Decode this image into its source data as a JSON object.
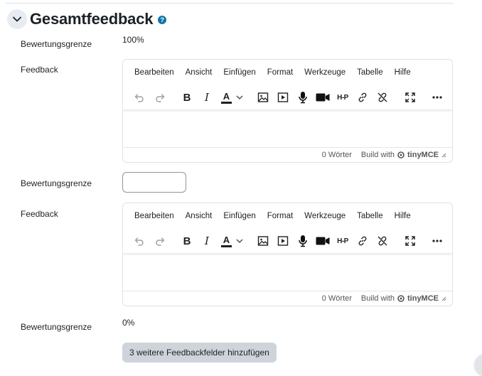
{
  "section": {
    "title": "Gesamtfeedback",
    "help_glyph": "?"
  },
  "rows": {
    "grade_label_1": "Bewertungsgrenze",
    "grade_value_1": "100%",
    "feedback_label_1": "Feedback",
    "grade_label_2": "Bewertungsgrenze",
    "grade_input_value": "",
    "feedback_label_2": "Feedback",
    "grade_label_3": "Bewertungsgrenze",
    "grade_value_3": "0%"
  },
  "editor": {
    "menu": [
      "Bearbeiten",
      "Ansicht",
      "Einfügen",
      "Format",
      "Werkzeuge",
      "Tabelle",
      "Hilfe"
    ],
    "toolbar_icons": [
      "undo-icon",
      "redo-icon",
      "bold-icon",
      "italic-icon",
      "text-color-icon",
      "image-icon",
      "media-icon",
      "microphone-icon",
      "video-camera-icon",
      "h5p-icon",
      "link-icon",
      "unlink-icon",
      "fullscreen-icon",
      "more-icon"
    ],
    "bold_glyph": "B",
    "italic_glyph": "I",
    "color_glyph": "A",
    "h5p_text": "H-P",
    "word_count": "0 Wörter",
    "brand_text": "Build with",
    "brand_logo": "tinyMCE"
  },
  "actions": {
    "add_fields": "3 weitere Feedbackfelder hinzufügen"
  },
  "colors": {
    "accent": "#1177a8",
    "button_bg": "#ced4da",
    "text": "#1d2125"
  }
}
